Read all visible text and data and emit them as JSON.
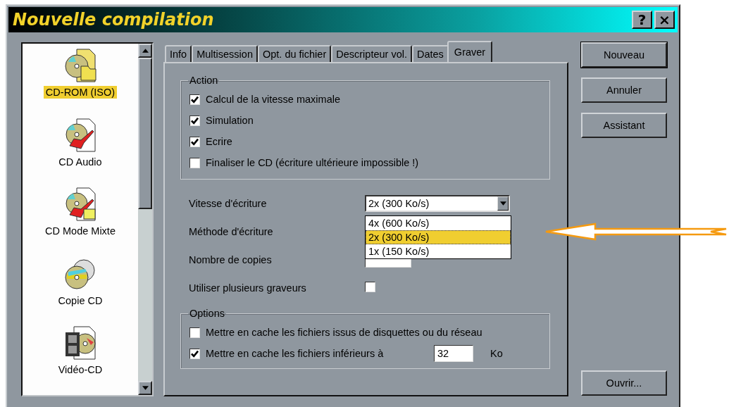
{
  "window": {
    "title": "Nouvelle compilation",
    "help_button": "?",
    "close_button": "×"
  },
  "project_types": [
    {
      "label": "CD-ROM (ISO)",
      "kind": "iso",
      "selected": true
    },
    {
      "label": "CD Audio",
      "kind": "audio",
      "selected": false
    },
    {
      "label": "CD Mode Mixte",
      "kind": "mixed",
      "selected": false
    },
    {
      "label": "Copie CD",
      "kind": "copy",
      "selected": false
    },
    {
      "label": "Vidéo-CD",
      "kind": "video",
      "selected": false
    }
  ],
  "tabs": [
    {
      "label": "Info",
      "selected": false
    },
    {
      "label": "Multisession",
      "selected": false
    },
    {
      "label": "Opt. du fichier",
      "selected": false
    },
    {
      "label": "Descripteur vol.",
      "selected": false
    },
    {
      "label": "Dates",
      "selected": false
    },
    {
      "label": "Graver",
      "selected": true
    }
  ],
  "action_group": {
    "title": "Action",
    "options": [
      {
        "label": "Calcul de la vitesse maximale",
        "checked": true
      },
      {
        "label": "Simulation",
        "checked": true
      },
      {
        "label": "Ecrire",
        "checked": true
      },
      {
        "label": "Finaliser le CD (écriture ultérieure impossible !)",
        "checked": false
      }
    ]
  },
  "write_speed": {
    "label": "Vitesse d'écriture",
    "value": "2x (300 Ko/s)",
    "options": [
      {
        "label": "4x (600 Ko/s)",
        "selected": false
      },
      {
        "label": "2x (300 Ko/s)",
        "selected": true
      },
      {
        "label": "1x (150 Ko/s)",
        "selected": false
      }
    ]
  },
  "write_method": {
    "label": "Méthode d'écriture"
  },
  "copies": {
    "label": "Nombre de copies"
  },
  "multiple_writers": {
    "label": "Utiliser plusieurs graveurs",
    "checked": false
  },
  "options_group": {
    "title": "Options",
    "cache_network": {
      "label": "Mettre en cache les fichiers issus de disquettes ou du réseau",
      "checked": false
    },
    "cache_small": {
      "label": "Mettre en cache les fichiers inférieurs à",
      "checked": true,
      "value": "32",
      "unit": "Ko"
    }
  },
  "buttons": [
    {
      "label": "Nouveau",
      "default": true
    },
    {
      "label": "Annuler",
      "default": false
    },
    {
      "label": "Assistant",
      "default": false
    }
  ],
  "open_button": {
    "label": "Ouvrir...",
    "default": false
  }
}
